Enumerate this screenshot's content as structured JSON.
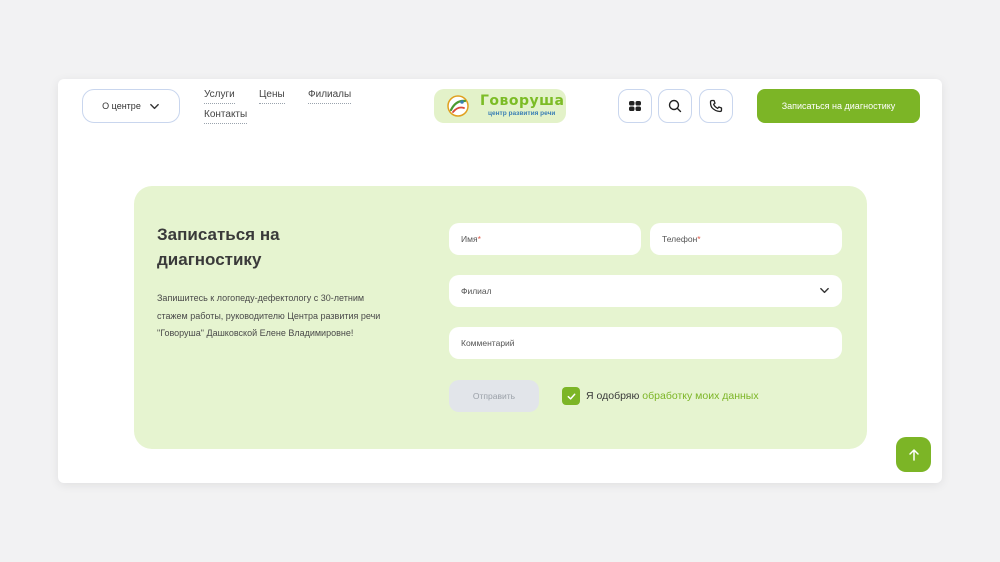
{
  "header": {
    "about_label": "О центре",
    "nav": [
      {
        "label": "Услуги"
      },
      {
        "label": "Цены"
      },
      {
        "label": "Филиалы"
      },
      {
        "label": "Контакты"
      }
    ],
    "logo": {
      "title": "Говоруша",
      "subtitle": "центр развития речи"
    },
    "icons": [
      "grid-icon",
      "search-icon",
      "phone-icon"
    ],
    "cta_label": "Записаться на диагностику"
  },
  "form": {
    "title": "Записаться на диагностику",
    "description": "Запишитесь к логопеду-дефектологу с 30-летним стажем работы, руководителю Центра развития речи \"Говоруша\" Дашковской Елене Владимировне!",
    "name_placeholder": "Имя",
    "phone_placeholder": "Телефон",
    "branch_placeholder": "Филиал",
    "comment_placeholder": "Комментарий",
    "required_mark": "*",
    "submit_label": "Отправить",
    "consent_checked": true,
    "consent_prefix": "Я одобряю ",
    "consent_link": "обработку моих данных"
  },
  "colors": {
    "accent": "#7cb526",
    "panel_bg": "#e6f4d0",
    "border": "#c9d6ee"
  }
}
